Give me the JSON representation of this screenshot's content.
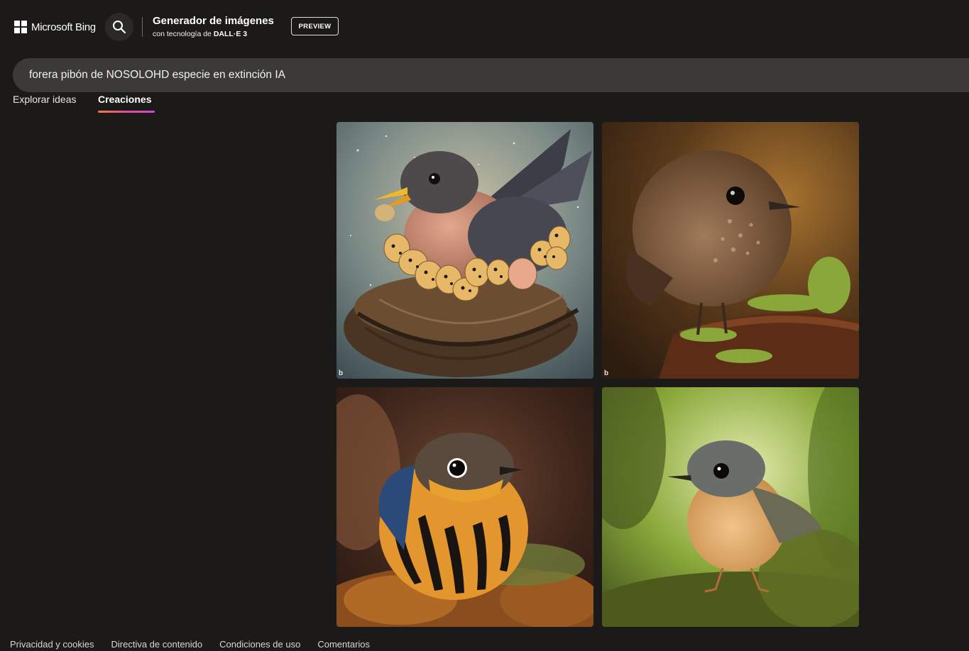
{
  "header": {
    "brand_name": "Microsoft Bing",
    "app_title": "Generador de imágenes",
    "app_subtitle_prefix": "con tecnología de ",
    "app_subtitle_engine": "DALL·E 3",
    "preview_label": "PREVIEW"
  },
  "prompt": {
    "value": "forera pibón de NOSOLOHD especie en extinción IA"
  },
  "tabs": [
    {
      "label": "Explorar ideas",
      "active": false
    },
    {
      "label": "Creaciones",
      "active": true
    }
  ],
  "images": [
    {
      "subject": "bird sitting on a nest of speckled eggs",
      "watermark": "b"
    },
    {
      "subject": "brown wren on a mossy branch",
      "watermark": "b"
    },
    {
      "subject": "orange and black striped bird on moss",
      "watermark": ""
    },
    {
      "subject": "small robin-like bird on green moss",
      "watermark": ""
    }
  ],
  "footer": {
    "links": [
      "Privacidad y cookies",
      "Directiva de contenido",
      "Condiciones de uso",
      "Comentarios"
    ]
  },
  "colors": {
    "background": "#1b1a19",
    "search_bar": "#3b3a39",
    "tab_underline_start": "#f2784b",
    "tab_underline_end": "#c64ad8"
  },
  "icons": {
    "search": "search-icon",
    "logo": "microsoft-logo-icon"
  }
}
